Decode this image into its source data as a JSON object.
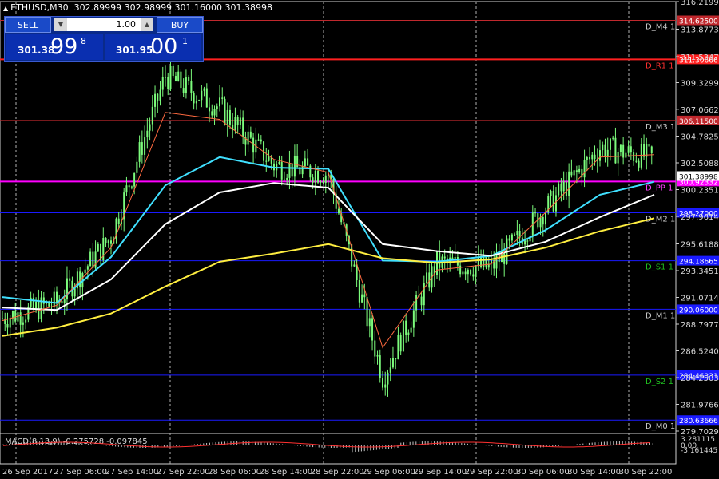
{
  "window": {
    "title_symbol": "ETHUSD,M30",
    "ohlc": "302.89999 302.98999 301.16000 301.38998"
  },
  "trade_panel": {
    "sell_label": "SELL",
    "buy_label": "BUY",
    "lot_value": "1.00",
    "sell_price": {
      "small": "301.38",
      "big": "99",
      "sup": "8"
    },
    "buy_price": {
      "small": "301.95",
      "big": "00",
      "sup": "1"
    }
  },
  "y_axis": {
    "ticks": [
      "316.21990",
      "313.87730",
      "311.53470",
      "309.32990",
      "307.06620",
      "304.78250",
      "302.50880",
      "300.23510",
      "297.96140",
      "295.61880",
      "293.34510",
      "291.07140",
      "288.79770",
      "286.52400",
      "284.25030",
      "281.97660",
      "279.70290"
    ],
    "current_price": "301.38998"
  },
  "x_axis": {
    "labels": [
      "26 Sep 2017",
      "27 Sep 06:00",
      "27 Sep 14:00",
      "27 Sep 22:00",
      "28 Sep 06:00",
      "28 Sep 14:00",
      "28 Sep 22:00",
      "29 Sep 06:00",
      "29 Sep 14:00",
      "29 Sep 22:00",
      "30 Sep 06:00",
      "30 Sep 14:00",
      "30 Sep 22:00"
    ]
  },
  "levels": [
    {
      "name": "D_M4 1",
      "price": "314.62500",
      "color": "#c0282d",
      "label_color": "#c8c8c8"
    },
    {
      "name": "D_R1 1",
      "price": "311.30666",
      "color": "#ff2020",
      "label_color": "#ff3030"
    },
    {
      "name": "D_M3 1",
      "price": "306.11500",
      "color": "#c0282d",
      "label_color": "#c8c8c8"
    },
    {
      "name": "D_PP 1",
      "price": "300.92332",
      "color": "#ff00ff",
      "label_color": "#ff40ff"
    },
    {
      "name": "D_M2 1",
      "price": "298.27000",
      "color": "#1a1aff",
      "label_color": "#c8c8c8"
    },
    {
      "name": "D_S1 1",
      "price": "294.18665",
      "color": "#1a1aff",
      "label_color": "#20c020"
    },
    {
      "name": "D_M1 1",
      "price": "290.06000",
      "color": "#1a1aff",
      "label_color": "#c8c8c8"
    },
    {
      "name": "D_S2 1",
      "price": "284.46331",
      "color": "#1a1aff",
      "label_color": "#20c020"
    },
    {
      "name": "D_M0 1",
      "price": "280.63666",
      "color": "#1a1aff",
      "label_color": "#c8c8c8"
    }
  ],
  "macd": {
    "label": "MACD(8,13,9) -0.275728 -0.097845",
    "ticks": [
      "3.281115",
      "0.00",
      "-3.161445"
    ]
  },
  "chart_data": {
    "type": "line",
    "title": "ETHUSD,M30",
    "ylim": [
      279.7029,
      316.2199
    ],
    "x": [
      "26 Sep 2017",
      "27 Sep 06:00",
      "27 Sep 14:00",
      "27 Sep 22:00",
      "28 Sep 06:00",
      "28 Sep 14:00",
      "28 Sep 22:00",
      "29 Sep 06:00",
      "29 Sep 14:00",
      "29 Sep 22:00",
      "30 Sep 06:00",
      "30 Sep 14:00",
      "30 Sep 22:00"
    ],
    "series": [
      {
        "color": "#7cfc7c",
        "values": [
          289.3,
          290.6,
          296.2,
          309.9,
          307.2,
          302.3,
          301.6,
          284.3,
          294.0,
          293.6,
          298.6,
          303.8,
          302.9
        ]
      },
      {
        "color": "#40e0ff",
        "values": [
          291.1,
          290.6,
          294.5,
          300.6,
          303.0,
          302.1,
          302.0,
          294.2,
          294.1,
          294.6,
          296.8,
          299.8,
          300.9
        ]
      },
      {
        "color": "#ffffff",
        "values": [
          290.2,
          290.0,
          292.6,
          297.3,
          300.0,
          300.8,
          300.4,
          295.6,
          295.0,
          294.6,
          295.8,
          297.9,
          299.8
        ]
      },
      {
        "color": "#ffee40",
        "values": [
          287.8,
          288.5,
          289.7,
          292.0,
          294.1,
          294.8,
          295.6,
          294.4,
          294.0,
          294.3,
          295.3,
          296.7,
          297.8
        ]
      },
      {
        "color": "#ff6a40",
        "values": [
          289.1,
          290.4,
          295.3,
          306.8,
          306.2,
          302.8,
          301.7,
          286.8,
          293.4,
          293.9,
          298.3,
          303.0,
          303.2
        ]
      }
    ]
  }
}
